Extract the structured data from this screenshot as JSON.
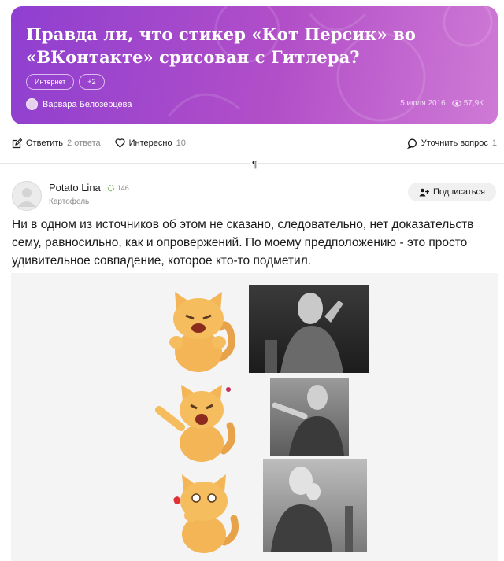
{
  "question": {
    "title": "Правда ли, что стикер «Кот Персик» во «ВКонтакте» срисован с Гитлера?",
    "tags": [
      "Интернет",
      "+2"
    ],
    "author": "Варвара Белозерцева",
    "date": "5 июля 2016",
    "views": "57,9К",
    "colors": {
      "gradient_start": "#8f3fd0",
      "gradient_end": "#cf7ad6"
    }
  },
  "actions": {
    "answer_label": "Ответить",
    "answer_count": "2 ответа",
    "interesting_label": "Интересно",
    "interesting_count": "10",
    "clarify_label": "Уточнить вопрос",
    "clarify_count": "1"
  },
  "answer": {
    "name": "Potato Lina",
    "karma": "146",
    "role": "Картофель",
    "subscribe_label": "Подписаться",
    "text": "Ни в одном из источников об этом не сказано, следовательно, нет доказательств сему, равносильно, как и опровержений.  По моему предположению - это просто удивительное совпадение, которое кто-то подметил."
  },
  "icons": [
    "edit-icon",
    "heart-icon",
    "question-bubble-icon",
    "eye-icon",
    "add-person-icon",
    "karma-icon"
  ]
}
